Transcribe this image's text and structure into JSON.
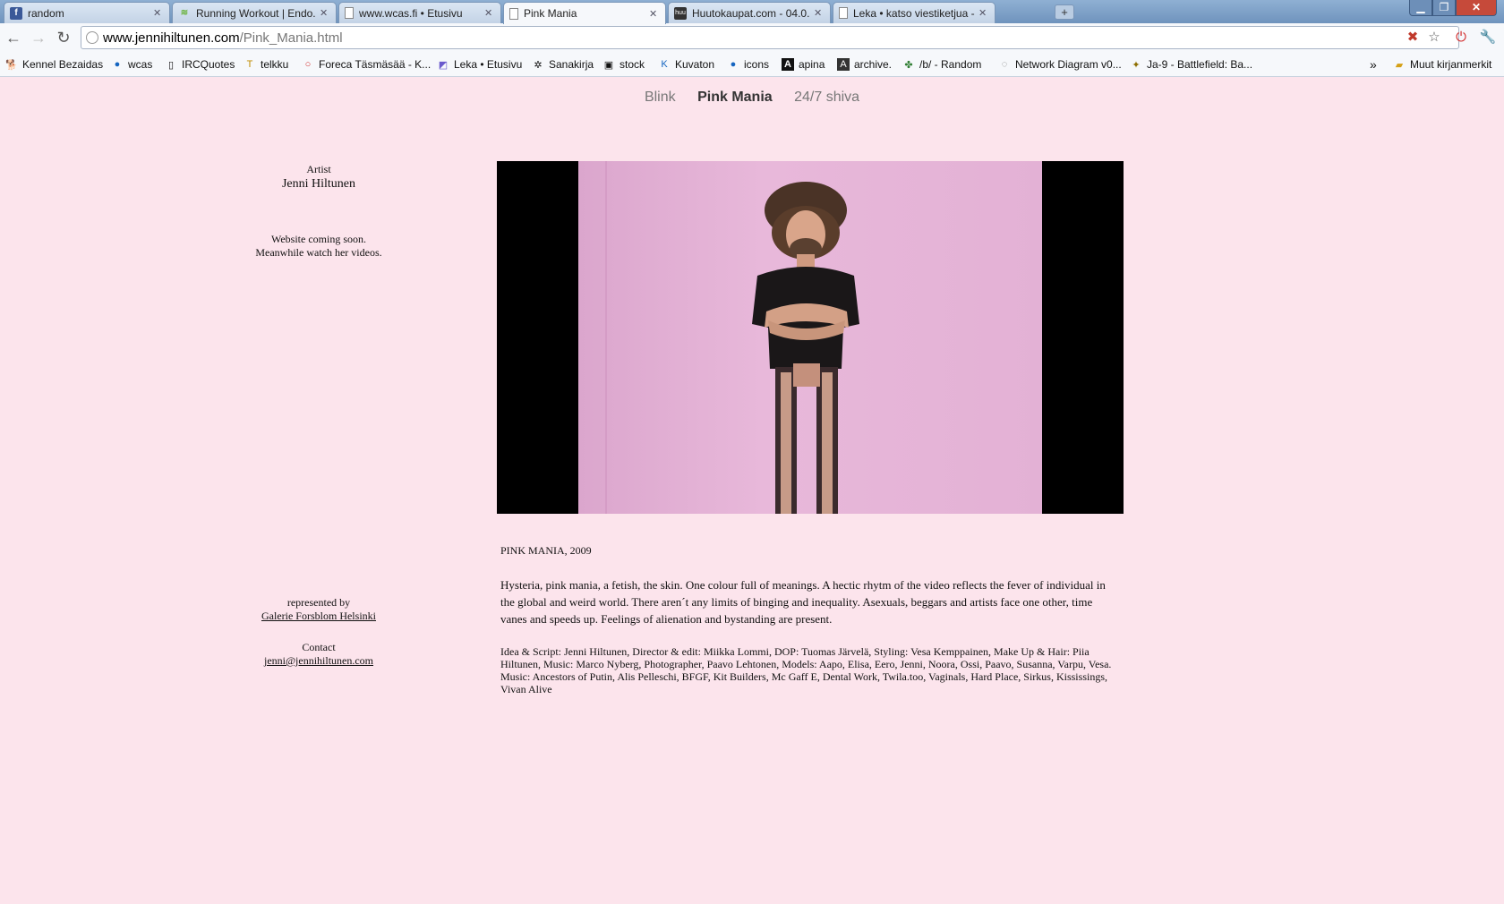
{
  "browser": {
    "tabs": [
      {
        "label": "random",
        "icon": "facebook-icon"
      },
      {
        "label": "Running Workout | Endo...",
        "icon": "endomondo-icon"
      },
      {
        "label": "www.wcas.fi • Etusivu",
        "icon": "page-icon"
      },
      {
        "label": "Pink Mania",
        "icon": "page-icon",
        "active": true
      },
      {
        "label": "Huutokaupat.com - 04.0...",
        "icon": "huuto-icon"
      },
      {
        "label": "Leka • katso viestiketjua -...",
        "icon": "page-icon"
      }
    ],
    "new_tab": "+",
    "url_host": "www.jennihiltunen.com",
    "url_path": "/Pink_Mania.html",
    "bookmarks": [
      {
        "label": "Kennel Bezaidas",
        "icon": "dog-icon"
      },
      {
        "label": "wcas",
        "icon": "drop-icon"
      },
      {
        "label": "IRCQuotes",
        "icon": "page-icon"
      },
      {
        "label": "telkku",
        "icon": "tv-icon"
      },
      {
        "label": "Foreca Täsmäsää - K...",
        "icon": "weather-icon"
      },
      {
        "label": "Leka • Etusivu",
        "icon": "leka-icon"
      },
      {
        "label": "Sanakirja",
        "icon": "star-icon"
      },
      {
        "label": "stock",
        "icon": "photo-icon"
      },
      {
        "label": "Kuvaton",
        "icon": "k-icon"
      },
      {
        "label": "icons",
        "icon": "drop-icon"
      },
      {
        "label": "apina",
        "icon": "a-icon"
      },
      {
        "label": "archive.",
        "icon": "archive-icon"
      },
      {
        "label": "/b/ - Random",
        "icon": "clover-icon"
      },
      {
        "label": "Network Diagram v0...",
        "icon": "network-icon"
      },
      {
        "label": "Ja-9 - Battlefield: Ba...",
        "icon": "soldier-icon"
      }
    ],
    "bookmarks_overflow": "»",
    "other_bookmarks": "Muut kirjanmerkit"
  },
  "site": {
    "nav": [
      {
        "label": "Blink"
      },
      {
        "label": "Pink Mania",
        "current": true
      },
      {
        "label": "24/7 shiva"
      }
    ],
    "sidebar": {
      "artist_label": "Artist",
      "artist_name": "Jenni Hiltunen",
      "note_line1": "Website coming soon.",
      "note_line2": "Meanwhile watch her videos.",
      "represented_label": "represented by",
      "gallery_link": "Galerie Forsblom Helsinki",
      "contact_label": "Contact",
      "contact_email": "jenni@jennihiltunen.com"
    },
    "work": {
      "title": "PINK MANIA, 2009",
      "description": "Hysteria, pink mania, a fetish, the skin. One colour full of meanings. A hectic rhytm of the video reflects the fever of individual in the global and weird world. There aren´t any limits of binging and inequality. Asexuals, beggars and artists face one other, time vanes and speeds up. Feelings of alienation and bystanding are present.",
      "credits": "Idea & Script: Jenni Hiltunen, Director & edit: Miikka Lommi, DOP: Tuomas Järvelä, Styling: Vesa Kemppainen, Make Up & Hair: Piia Hiltunen, Music: Marco Nyberg, Photographer, Paavo Lehtonen, Models: Aapo, Elisa, Eero, Jenni, Noora, Ossi, Paavo, Susanna, Varpu, Vesa. Music: Ancestors of Putin, Alis Pelleschi, BFGF, Kit Builders, Mc Gaff E, Dental Work, Twila.too, Vaginals, Hard Place, Sirkus, Kississings, Vivan Alive"
    }
  },
  "colors": {
    "page_bg": "#fce4ec",
    "video_bg": "#000000",
    "video_wall": "#e3b1d5"
  }
}
